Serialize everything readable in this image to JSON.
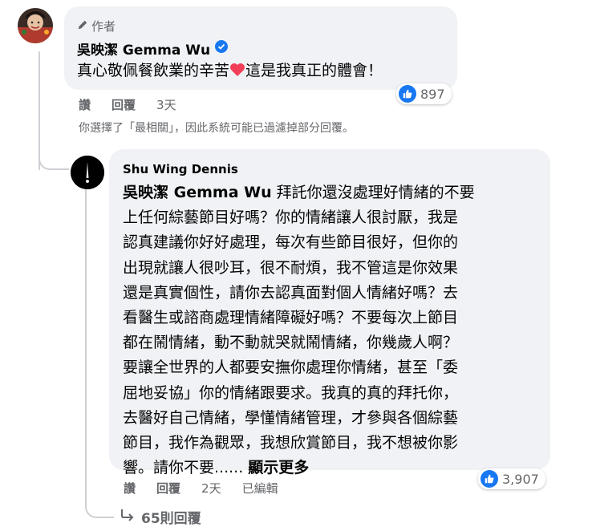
{
  "comment": {
    "author_badge": "作者",
    "name": "吳映潔 Gemma Wu",
    "text": "真心敬佩餐飲業的辛苦",
    "text_after_heart": "這是我真正的體會！",
    "reaction_count": "897",
    "actions": {
      "like": "讚",
      "reply": "回覆",
      "time": "3天"
    }
  },
  "filter_note": "你選擇了「最相關」，因此系統可能已過濾掉部分回覆。",
  "reply": {
    "name": "Shu Wing Dennis",
    "mention": "吳映潔 Gemma Wu",
    "lines": [
      " 拜託你還沒處理好情緒的不要",
      "上任何綜藝節目好嗎？你的情緒讓人很討厭，我是",
      "認真建議你好好處理，每次有些節目很好，但你的",
      "出現就讓人很吵耳，很不耐煩，我不管這是你效果",
      "還是真實個性，請你去認真面對個人情緒好嗎？去",
      "看醫生或諮商處理情緒障礙好嗎？不要每次上節目",
      "都在鬧情緒，動不動就哭就鬧情緒，你幾歲人啊？",
      "要讓全世界的人都要安撫你處理你情緒，甚至「委",
      "屈地妥協」你的情緒跟要求。我真的真的拜托你，",
      "去醫好自己情緒，學懂情緒管理，才參與各個綜藝",
      "節目，我作為觀眾，我想欣賞節目，我不想被你影",
      "響。請你不要......"
    ],
    "see_more": "顯示更多",
    "reaction_count": "3,907",
    "actions": {
      "like": "讚",
      "reply": "回覆",
      "time": "2天",
      "edited": "已編輯"
    }
  },
  "replies_link": "65則回覆",
  "colors": {
    "bubble": "#f0f2f5",
    "like_blue": "#1877f2",
    "heart_red": "#f33e58",
    "muted": "#65676b"
  },
  "icons": [
    "pen-icon",
    "verified-badge-icon",
    "heart-emoji-icon",
    "like-icon",
    "reply-arrow-icon"
  ]
}
